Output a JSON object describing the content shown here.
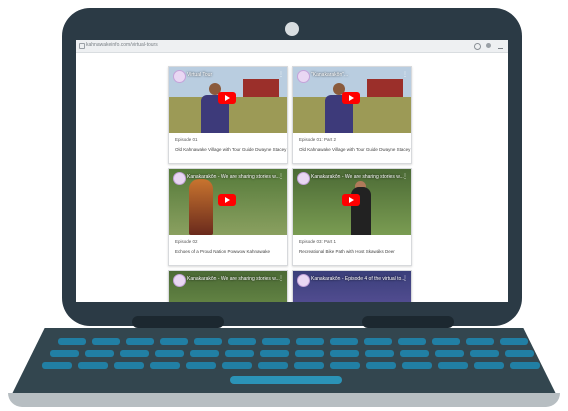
{
  "browser": {
    "url": "kahnawakeinfo.com/virtual-tours"
  },
  "videos": [
    {
      "title": "Virtual Tour",
      "episode": "Episode 01",
      "description": "Old Kahnawake Village with Tour Guide Dwayne Stacey"
    },
    {
      "title": "\"Kanakarakôn\"...",
      "episode": "Episode 01: Part 2",
      "description": "Old Kahnawake Village with Tour Guide Dwayne Stacey"
    },
    {
      "title": "Kanakarakôn - We are sharing stories w...",
      "episode": "Episode 02",
      "description": "Echoes of a Proud Nation Powwow Kahnawake"
    },
    {
      "title": "Kanakarakôn - We are sharing stories w...",
      "episode": "Episode 03: Part 1",
      "description": "Recreational Bike Path with Host Skawáks Deer"
    },
    {
      "title": "Kanakarakôn - We are sharing stories w...",
      "episode": "",
      "description": ""
    },
    {
      "title": "Kanakarakôn - Episode 4 of the virtual to...",
      "episode": "",
      "description": ""
    }
  ],
  "colors": {
    "bezel": "#2b3a45",
    "keys": "#1f8ab3",
    "play": "#ff0000"
  }
}
